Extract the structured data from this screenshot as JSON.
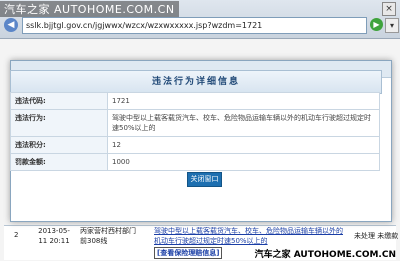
{
  "browser": {
    "watermark": "汽车之家 AUTOHOME.COM.CN",
    "url": "sslk.bjjtgl.gov.cn/jgjwwx/wzcx/wzxwxxxxx.jsp?wzdm=1721",
    "close_glyph": "×",
    "back_glyph": "◀",
    "go_glyph": "▶",
    "ext_glyph": "▾"
  },
  "modal": {
    "title": "违法行为详细信息",
    "rows": [
      {
        "label": "违法代码:",
        "value": "1721"
      },
      {
        "label": "违法行为:",
        "value": "驾驶中型以上载客载货汽车、校车、危险物品运输车辆以外的机动车行驶超过规定时速50%以上的"
      },
      {
        "label": "违法积分:",
        "value": "12"
      },
      {
        "label": "罚款金额:",
        "value": "1000"
      }
    ],
    "close_button": "关闭窗口"
  },
  "background_table": {
    "row": {
      "index": "2",
      "time": "2013-05-11 20:11",
      "place": "丙家营村西村部门前308线",
      "action": "驾驶中型以上载客载货汽车、校车、危险物品运输车辆以外的机动车行驶超过规定时速50%以上的",
      "status": "未处理 未缴款"
    },
    "link": "[查看保险理赔信息]"
  },
  "footer_watermark": "汽车之家 AUTOHOME.COM.CN"
}
